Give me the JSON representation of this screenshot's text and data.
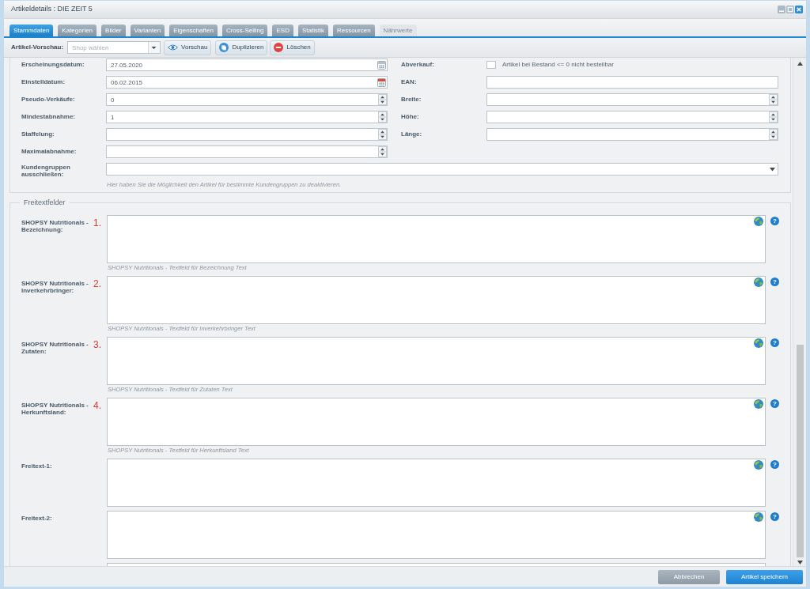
{
  "window": {
    "title": "Artikeldetails : DIE ZEIT 5"
  },
  "tabs": [
    {
      "label": "Stammdaten",
      "selected": true,
      "disabled": false
    },
    {
      "label": "Kategorien",
      "selected": false,
      "disabled": false
    },
    {
      "label": "Bilder",
      "selected": false,
      "disabled": false
    },
    {
      "label": "Varianten",
      "selected": false,
      "disabled": false
    },
    {
      "label": "Eigenschaften",
      "selected": false,
      "disabled": false
    },
    {
      "label": "Cross-Selling",
      "selected": false,
      "disabled": false
    },
    {
      "label": "ESD",
      "selected": false,
      "disabled": false
    },
    {
      "label": "Statistik",
      "selected": false,
      "disabled": false
    },
    {
      "label": "Ressourcen",
      "selected": false,
      "disabled": false
    },
    {
      "label": "Nährwerte",
      "selected": false,
      "disabled": true
    }
  ],
  "toolbar": {
    "label": "Artikel-Vorschau:",
    "shop_select": {
      "placeholder": "Shop wählen"
    },
    "buttons": [
      {
        "label": "Vorschau",
        "kind": "preview"
      },
      {
        "label": "Duplizieren",
        "kind": "duplicate"
      },
      {
        "label": "Löschen",
        "kind": "delete"
      }
    ]
  },
  "settings": {
    "left_fields": [
      {
        "label": "Erscheinungsdatum:",
        "kind": "date",
        "value": "27.05.2020",
        "highlighted": false
      },
      {
        "label": "Einstelldatum:",
        "kind": "date",
        "value": "06.02.2015",
        "highlighted": true
      },
      {
        "label": "Pseudo-Verkäufe:",
        "kind": "number",
        "value": "0"
      },
      {
        "label": "Mindestabnahme:",
        "kind": "number",
        "value": "1"
      },
      {
        "label": "Staffelung:",
        "kind": "number"
      },
      {
        "label": "Maximalabnahme:",
        "kind": "number"
      }
    ],
    "right_fields": [
      {
        "label": "Abverkauf:",
        "kind": "checkbox",
        "checked": false,
        "text": "Artikel bei Bestand <= 0 nicht bestellbar"
      },
      {
        "label": "EAN:",
        "kind": "text"
      },
      {
        "label": "Breite:",
        "kind": "number"
      },
      {
        "label": "Höhe:",
        "kind": "number"
      },
      {
        "label": "Länge:",
        "kind": "number"
      }
    ],
    "customer_groups": {
      "label": "Kundengruppen ausschließen:",
      "hint": "Hier haben Sie die Möglichkeit den Artikel für bestimmte Kundengruppen zu deaktivieren."
    }
  },
  "free_text": {
    "legend": "Freitextfelder",
    "fields": [
      {
        "label": "SHOPSY Nutritionals - Bezeichnung:",
        "marker": "1.",
        "hint": "SHOPSY Nutritionals - Textfeld für Bezeichnung Text",
        "help": "?"
      },
      {
        "label": "SHOPSY Nutritionals - Inverkehrbringer:",
        "marker": "2.",
        "hint": "SHOPSY Nutritionals - Textfeld für Inverkehrbringer Text",
        "help": "?"
      },
      {
        "label": "SHOPSY Nutritionals - Zutaten:",
        "marker": "3.",
        "hint": "SHOPSY Nutritionals - Textfeld für Zutaten Text",
        "help": "?"
      },
      {
        "label": "SHOPSY Nutritionals - Herkunftsland:",
        "marker": "4.",
        "hint": "SHOPSY Nutritionals - Textfeld für Herkunftsland Text",
        "help": "?"
      },
      {
        "label": "Freitext-1:",
        "help": "?"
      },
      {
        "label": "Freitext-2:",
        "help": "?"
      }
    ]
  },
  "footer": {
    "buttons": [
      {
        "label": "Abbrechen",
        "kind": "cancel"
      },
      {
        "label": "Artikel speichern",
        "kind": "save"
      }
    ]
  }
}
